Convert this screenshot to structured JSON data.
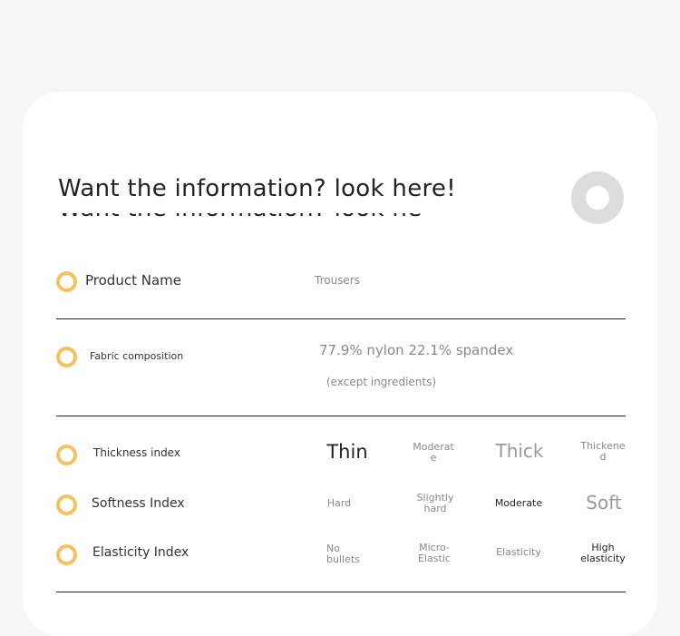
{
  "header": {
    "title": "Want the information? look here!"
  },
  "rows": [
    {
      "label": "Product Name",
      "value": "Trousers"
    },
    {
      "label": "Fabric composition",
      "value": "77.9% nylon 22.1% spandex",
      "note": "(except ingredients)"
    },
    {
      "label": "Thickness index",
      "options": [
        "Thin",
        "Moderat\ne",
        "Thick",
        "Thickene\nd"
      ]
    },
    {
      "label": "Softness Index",
      "options": [
        "Hard",
        "Slightly\nhard",
        "Moderate",
        "Soft"
      ]
    },
    {
      "label": "Elasticity Index",
      "options": [
        "No\nbullets",
        "Micro-\nElastic",
        "Elasticity",
        "High\nelasticity"
      ]
    }
  ],
  "colors": {
    "accent_ring": "#f5c25e",
    "deco_ring": "#dcdcdc",
    "card": "#ffffff",
    "background": "#f6f6f6"
  }
}
